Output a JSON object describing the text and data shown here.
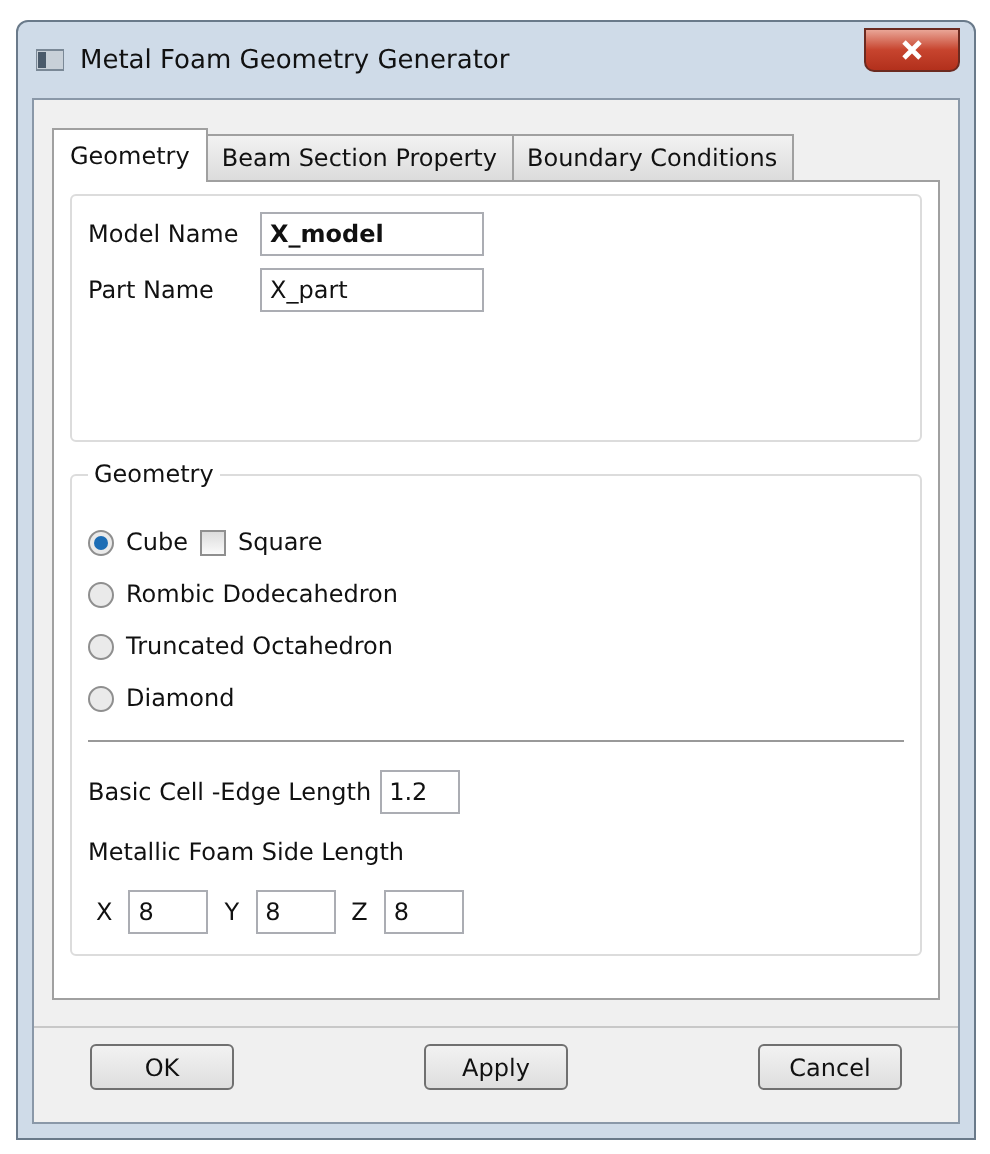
{
  "window": {
    "title": "Metal Foam Geometry Generator"
  },
  "tabs": [
    {
      "label": "Geometry",
      "selected": true
    },
    {
      "label": "Beam Section Property",
      "selected": false
    },
    {
      "label": "Boundary Conditions",
      "selected": false
    }
  ],
  "names": [
    {
      "label": "Model Name",
      "value": "X_model",
      "bold": true
    },
    {
      "label": "Part Name",
      "value": "X_part",
      "bold": false
    }
  ],
  "geometry": {
    "title": "Geometry",
    "shapes": [
      {
        "label": "Cube",
        "selected": true,
        "option": {
          "label": "Square",
          "checked": false
        }
      },
      {
        "label": "Rombic Dodecahedron",
        "selected": false
      },
      {
        "label": "Truncated Octahedron",
        "selected": false
      },
      {
        "label": "Diamond",
        "selected": false
      }
    ],
    "edge_length": {
      "label": "Basic Cell -Edge Length",
      "value": "1.2"
    },
    "side_length": {
      "label": "Metallic Foam Side Length",
      "axes": [
        {
          "label": "X",
          "value": "8"
        },
        {
          "label": "Y",
          "value": "8"
        },
        {
          "label": "Z",
          "value": "8"
        }
      ]
    }
  },
  "buttons": [
    "OK",
    "Apply",
    "Cancel"
  ]
}
